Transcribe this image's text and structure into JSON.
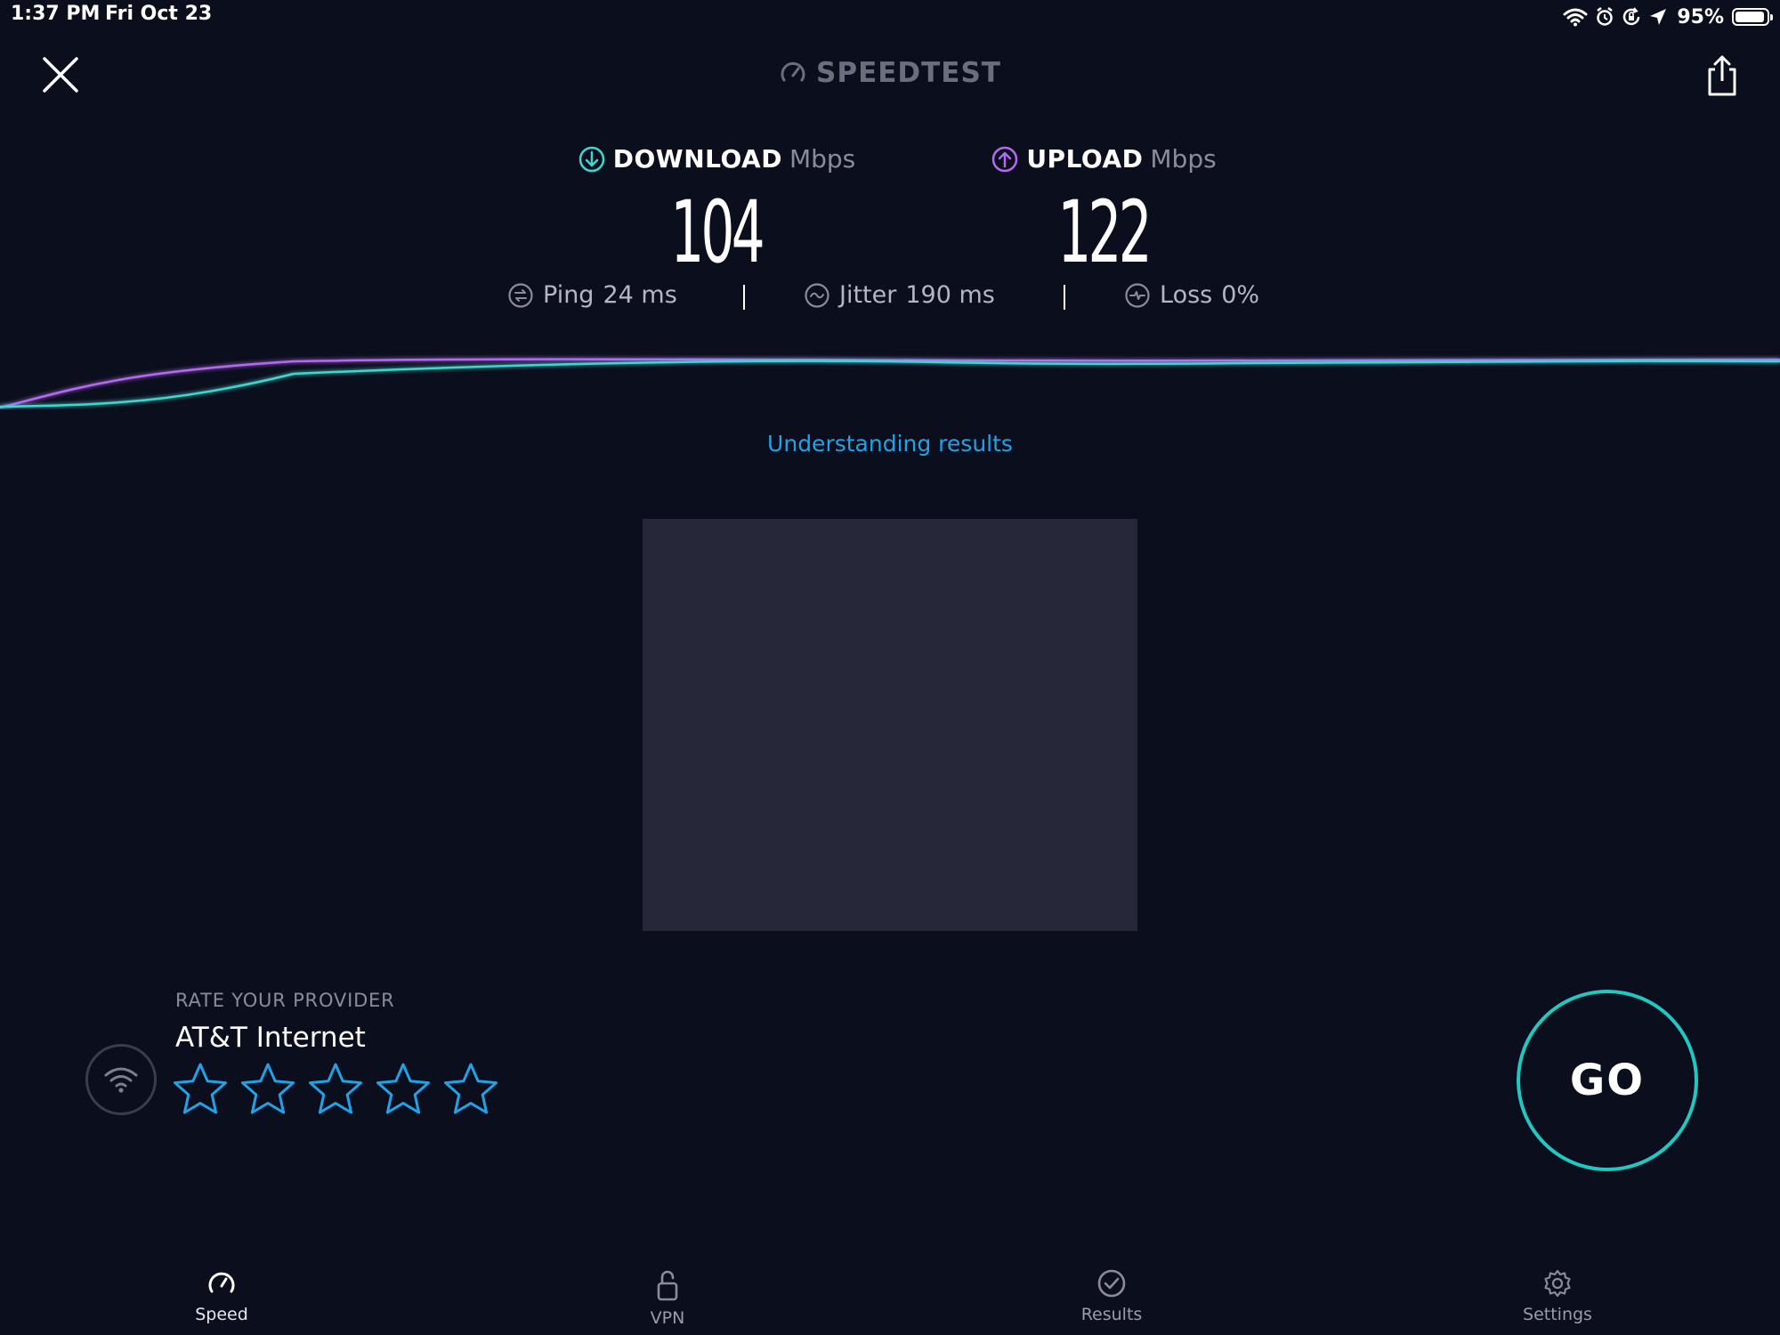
{
  "status_bar": {
    "time": "1:37 PM",
    "date": "Fri Oct 23",
    "battery_percent": "95%",
    "battery_level": 0.95,
    "icons": [
      "wifi-icon",
      "alarm-icon",
      "orientation-lock-icon",
      "location-icon",
      "battery-icon"
    ]
  },
  "header": {
    "title": "SPEEDTEST",
    "title_icon": "speedometer-icon",
    "close_icon": "close-icon",
    "share_icon": "share-icon"
  },
  "download": {
    "label": "DOWNLOAD",
    "unit": "Mbps",
    "value": "104",
    "icon": "download-arrow-icon",
    "color": "#3fd6d0"
  },
  "upload": {
    "label": "UPLOAD",
    "unit": "Mbps",
    "value": "122",
    "icon": "upload-arrow-icon",
    "color": "#b36af0"
  },
  "stats": {
    "ping": {
      "label": "Ping",
      "value": "24 ms",
      "icon": "ping-icon"
    },
    "jitter": {
      "label": "Jitter",
      "value": "190 ms",
      "icon": "jitter-icon"
    },
    "loss": {
      "label": "Loss",
      "value": "0%",
      "icon": "loss-icon"
    }
  },
  "understanding_link": "Understanding results",
  "rate_provider": {
    "section_label": "RATE YOUR PROVIDER",
    "provider_name": "AT&T Internet",
    "star_count": 5,
    "selected_rating": 0,
    "star_color": "#1fa3e8"
  },
  "go_button": {
    "label": "GO",
    "ring_color": "#20c8c3"
  },
  "tabs": [
    {
      "label": "Speed",
      "icon": "speedometer-icon",
      "active": true
    },
    {
      "label": "VPN",
      "icon": "unlock-icon",
      "active": false
    },
    {
      "label": "Results",
      "icon": "checkmark-circle-icon",
      "active": false
    },
    {
      "label": "Settings",
      "icon": "gear-icon",
      "active": false
    }
  ],
  "colors": {
    "background": "#0b0e1c",
    "accent_blue": "#1fa3e8",
    "download_teal": "#3fd6d0",
    "upload_purple": "#b36af0"
  }
}
